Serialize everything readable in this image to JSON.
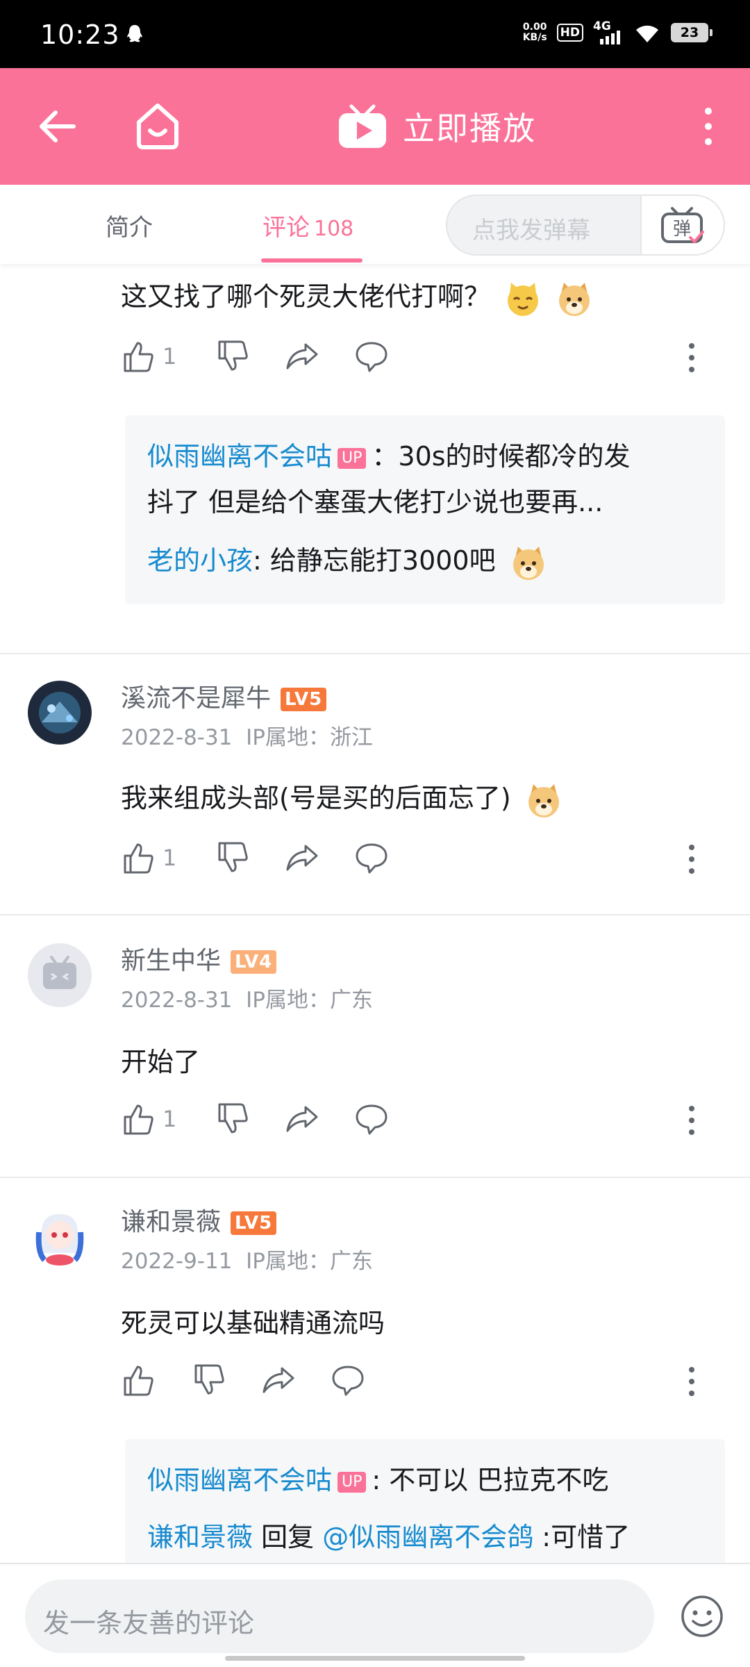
{
  "status_bar": {
    "time": "10:23",
    "net_speed_value": "0.00",
    "net_speed_unit": "KB/s",
    "hd_label": "HD",
    "network": "4G",
    "battery": "23"
  },
  "header": {
    "play_now_label": "立即播放"
  },
  "tabs": {
    "intro_label": "简介",
    "comments_label": "评论",
    "comments_count": "108",
    "danmaku_placeholder": "点我发弹幕",
    "danmaku_toggle_label": "弹"
  },
  "comments": [
    {
      "text": "这又找了哪个死灵大佬代打啊？",
      "likes": "1",
      "replies": [
        {
          "user": "似雨幽离不会咕",
          "tag": "UP",
          "text": "：30s的时候都冷的发"
        },
        {
          "user": "",
          "tag": "",
          "text": "抖了 但是给个塞蛋大佬打少说也要再..."
        },
        {
          "user": "老的小孩",
          "tag": "",
          "text": ": 给静忘能打3000吧"
        }
      ]
    },
    {
      "username": "溪流不是犀牛",
      "level": "LV5",
      "date": "2022-8-31",
      "ip": "IP属地：浙江",
      "text": "我来组成头部(号是买的后面忘了)",
      "likes": "1"
    },
    {
      "username": "新生中华",
      "level": "LV4",
      "date": "2022-8-31",
      "ip": "IP属地：广东",
      "text": "开始了",
      "likes": "1"
    },
    {
      "username": "谦和景薇",
      "level": "LV5",
      "date": "2022-9-11",
      "ip": "IP属地：广东",
      "text": "死灵可以基础精通流吗",
      "likes": "",
      "replies": [
        {
          "user": "似雨幽离不会咕",
          "tag": "UP",
          "text": ": 不可以 巴拉克不吃"
        },
        {
          "user": "谦和景薇",
          "tag": "",
          "text": " 回复 ",
          "mention": "@似雨幽离不会鸽",
          "suffix": " :可惜了"
        }
      ]
    }
  ],
  "bottom_bar": {
    "comment_placeholder": "发一条友善的评论"
  },
  "colors": {
    "brand_pink": "#fb7299",
    "username_blue": "#178bcf",
    "lv5_orange": "#f6793b",
    "lv4_orange": "#fbb07a"
  }
}
